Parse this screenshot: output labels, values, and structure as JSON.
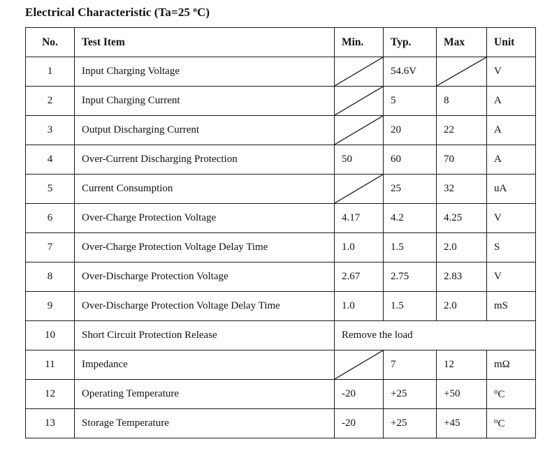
{
  "document": {
    "title_prefix": "Electrical Characteristic (Ta=25 ",
    "title_degree": "o",
    "title_suffix": "C)",
    "title_full": "Electrical Characteristic (Ta=25 ºC)"
  },
  "table": {
    "headers": {
      "no": "No.",
      "item": "Test Item",
      "min": "Min.",
      "typ": "Typ.",
      "max": "Max",
      "unit": "Unit"
    },
    "rows": [
      {
        "no": "1",
        "item": "Input Charging Voltage",
        "min": "",
        "min_slash": true,
        "typ": "54.6V",
        "typ_slash": false,
        "max": "",
        "max_slash": true,
        "unit": "V"
      },
      {
        "no": "2",
        "item": "Input Charging Current",
        "min": "",
        "min_slash": true,
        "typ": "5",
        "typ_slash": false,
        "max": "8",
        "max_slash": false,
        "unit": "A"
      },
      {
        "no": "3",
        "item": "Output Discharging Current",
        "min": "",
        "min_slash": true,
        "typ": "20",
        "typ_slash": false,
        "max": "22",
        "max_slash": false,
        "unit": "A"
      },
      {
        "no": "4",
        "item": "Over-Current Discharging Protection",
        "min": "50",
        "min_slash": false,
        "typ": "60",
        "typ_slash": false,
        "max": "70",
        "max_slash": false,
        "unit": "A"
      },
      {
        "no": "5",
        "item": "Current Consumption",
        "min": "",
        "min_slash": true,
        "typ": "25",
        "typ_slash": false,
        "max": "32",
        "max_slash": false,
        "unit": "uA"
      },
      {
        "no": "6",
        "item": "Over-Charge Protection Voltage",
        "min": "4.17",
        "min_slash": false,
        "typ": "4.2",
        "typ_slash": false,
        "max": "4.25",
        "max_slash": false,
        "unit": "V"
      },
      {
        "no": "7",
        "item": "Over-Charge Protection Voltage Delay Time",
        "min": "1.0",
        "min_slash": false,
        "typ": "1.5",
        "typ_slash": false,
        "max": "2.0",
        "max_slash": false,
        "unit": "S"
      },
      {
        "no": "8",
        "item": "Over-Discharge Protection Voltage",
        "min": "2.67",
        "min_slash": false,
        "typ": "2.75",
        "typ_slash": false,
        "max": "2.83",
        "max_slash": false,
        "unit": "V"
      },
      {
        "no": "9",
        "item": "Over-Discharge Protection Voltage Delay Time",
        "min": "1.0",
        "min_slash": false,
        "typ": "1.5",
        "typ_slash": false,
        "max": "2.0",
        "max_slash": false,
        "unit": "mS"
      },
      {
        "no": "10",
        "item": "Short Circuit Protection Release",
        "merged": true,
        "merged_value": "Remove the load"
      },
      {
        "no": "11",
        "item": "Impedance",
        "min": "",
        "min_slash": true,
        "typ": "7",
        "typ_slash": false,
        "max": "12",
        "max_slash": false,
        "unit": "mΩ"
      },
      {
        "no": "12",
        "item": "Operating Temperature",
        "min": "-20",
        "min_slash": false,
        "typ": "+25",
        "typ_slash": false,
        "max": "+50",
        "max_slash": false,
        "unit": "ºC"
      },
      {
        "no": "13",
        "item": "Storage Temperature",
        "min": "-20",
        "min_slash": false,
        "typ": "+25",
        "typ_slash": false,
        "max": "+45",
        "max_slash": false,
        "unit": "ºC"
      }
    ]
  },
  "style": {
    "border_color": "#1a1a1a",
    "text_color": "#111111",
    "background": "#ffffff"
  }
}
